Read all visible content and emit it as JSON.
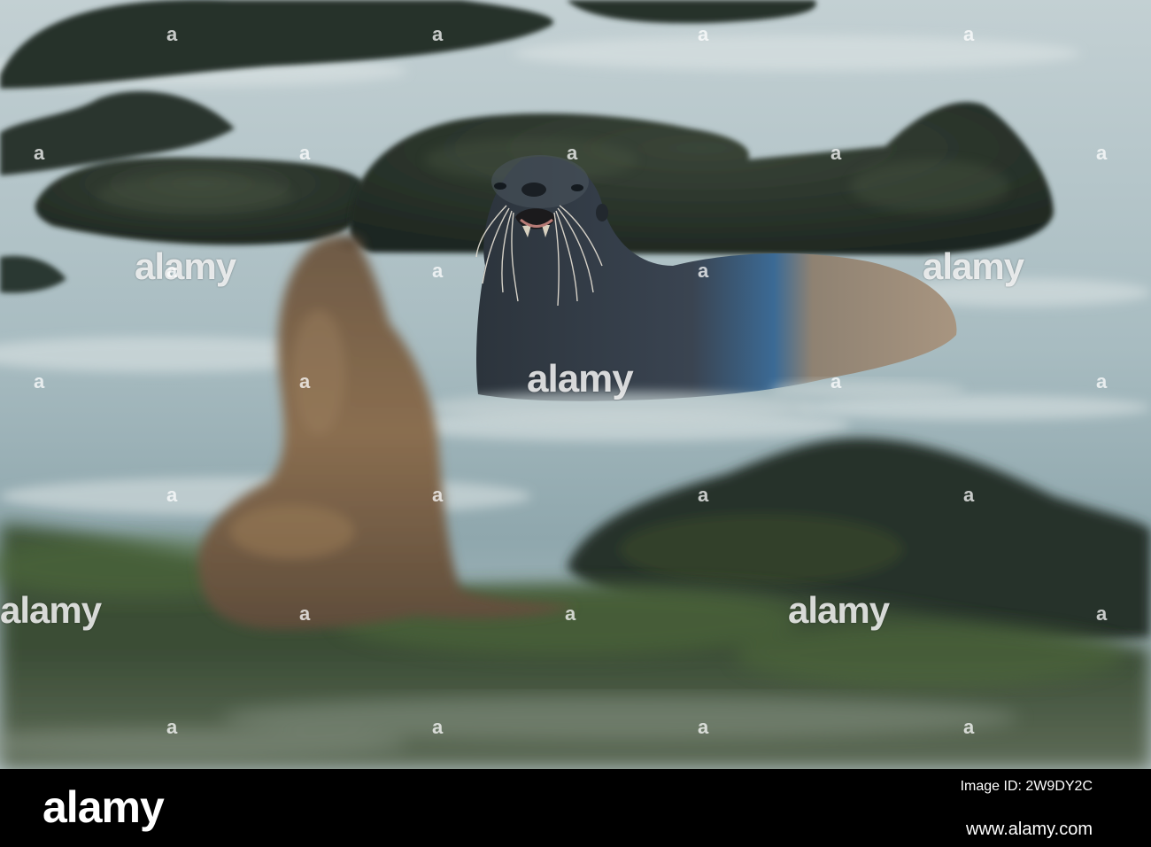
{
  "watermark": {
    "brand": "alamy",
    "small_mark": "a"
  },
  "footer": {
    "logo": "alamy",
    "image_id_label": "Image ID: 2W9DY2C",
    "site": "www.alamy.com"
  },
  "scene": {
    "subject": "sea lions",
    "colors": {
      "water": "#9fb6bc",
      "rock": "#2f3a2e",
      "moss": "#3e5a33",
      "sealion_body": "#343c44",
      "sealion_back": "#9c8a75",
      "pup": "#7a6247"
    }
  }
}
